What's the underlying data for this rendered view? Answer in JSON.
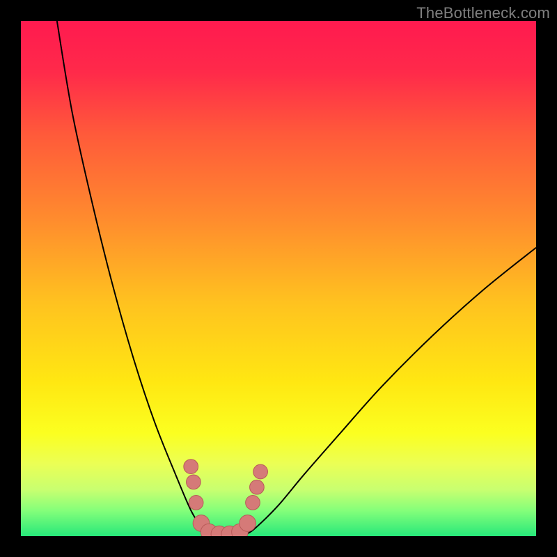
{
  "watermark": "TheBottleneck.com",
  "colors": {
    "gradient_stops": [
      {
        "offset": 0.0,
        "color": "#ff1a4f"
      },
      {
        "offset": 0.1,
        "color": "#ff2a4a"
      },
      {
        "offset": 0.22,
        "color": "#ff5a3a"
      },
      {
        "offset": 0.38,
        "color": "#ff8a2e"
      },
      {
        "offset": 0.55,
        "color": "#ffc31f"
      },
      {
        "offset": 0.7,
        "color": "#ffe712"
      },
      {
        "offset": 0.8,
        "color": "#fbff20"
      },
      {
        "offset": 0.86,
        "color": "#ebff55"
      },
      {
        "offset": 0.91,
        "color": "#c8ff70"
      },
      {
        "offset": 0.95,
        "color": "#85ff7a"
      },
      {
        "offset": 1.0,
        "color": "#27e87a"
      }
    ],
    "curve": "#000000",
    "marker_fill": "#d57a78",
    "marker_stroke": "#b85a58"
  },
  "chart_data": {
    "type": "line",
    "title": "",
    "xlabel": "",
    "ylabel": "",
    "xlim": [
      0,
      100
    ],
    "ylim": [
      0,
      100
    ],
    "series": [
      {
        "name": "left-curve",
        "x": [
          7,
          10,
          14,
          18,
          22,
          26,
          30,
          33,
          35,
          37,
          38
        ],
        "y": [
          100,
          82,
          64,
          48,
          34,
          22,
          12,
          5,
          2,
          0.5,
          0
        ]
      },
      {
        "name": "right-curve",
        "x": [
          42,
          44,
          46,
          50,
          55,
          62,
          70,
          80,
          90,
          100
        ],
        "y": [
          0,
          0.5,
          2,
          6,
          12,
          20,
          29,
          39,
          48,
          56
        ]
      }
    ],
    "markers": {
      "name": "highlighted-points",
      "points": [
        {
          "x": 33.0,
          "y": 13.5,
          "r": 1.4
        },
        {
          "x": 33.5,
          "y": 10.5,
          "r": 1.4
        },
        {
          "x": 34.0,
          "y": 6.5,
          "r": 1.4
        },
        {
          "x": 35.0,
          "y": 2.5,
          "r": 1.6
        },
        {
          "x": 36.5,
          "y": 0.8,
          "r": 1.6
        },
        {
          "x": 38.5,
          "y": 0.4,
          "r": 1.6
        },
        {
          "x": 40.5,
          "y": 0.4,
          "r": 1.6
        },
        {
          "x": 42.5,
          "y": 0.8,
          "r": 1.6
        },
        {
          "x": 44.0,
          "y": 2.5,
          "r": 1.6
        },
        {
          "x": 45.0,
          "y": 6.5,
          "r": 1.4
        },
        {
          "x": 45.8,
          "y": 9.5,
          "r": 1.4
        },
        {
          "x": 46.5,
          "y": 12.5,
          "r": 1.4
        }
      ]
    }
  }
}
